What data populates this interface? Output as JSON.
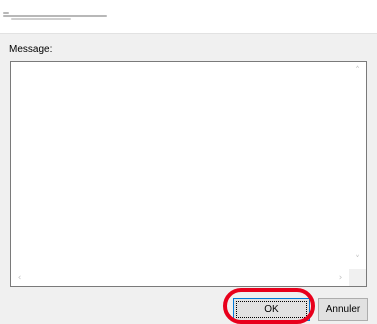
{
  "dialog": {
    "title_text": "",
    "message_label": "Message:",
    "message_value": "",
    "ok_label": "OK",
    "cancel_label": "Annuler"
  },
  "scrollbar_icons": {
    "up": "chevron-up-icon",
    "down": "chevron-down-icon",
    "left": "chevron-left-icon",
    "right": "chevron-right-icon"
  },
  "colors": {
    "highlight": "#e8001c",
    "focus_border": "#0078d7",
    "client_background": "#f0f0f0"
  }
}
